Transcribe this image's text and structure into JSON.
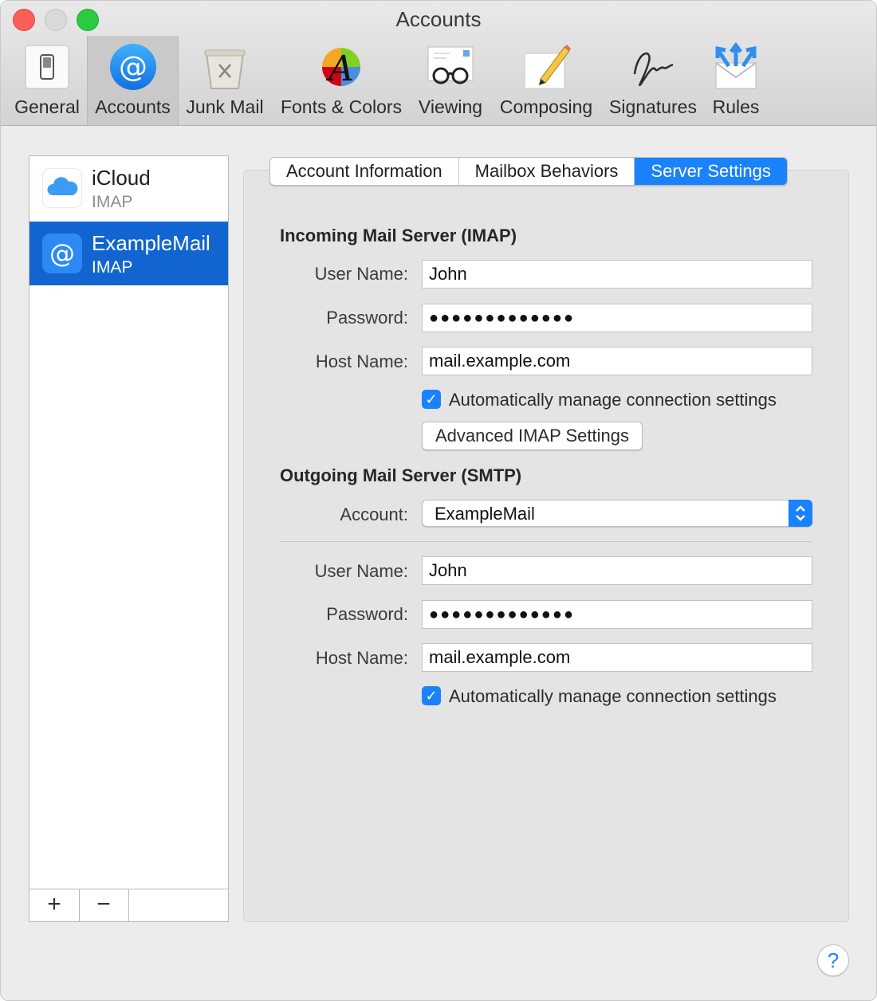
{
  "window": {
    "title": "Accounts"
  },
  "toolbar": {
    "items": [
      {
        "label": "General",
        "icon": "switch-icon"
      },
      {
        "label": "Accounts",
        "icon": "at-sign-icon"
      },
      {
        "label": "Junk Mail",
        "icon": "trash-bin-icon"
      },
      {
        "label": "Fonts & Colors",
        "icon": "font-color-wheel-icon"
      },
      {
        "label": "Viewing",
        "icon": "glasses-letter-icon"
      },
      {
        "label": "Composing",
        "icon": "pencil-paper-icon"
      },
      {
        "label": "Signatures",
        "icon": "signature-icon"
      },
      {
        "label": "Rules",
        "icon": "envelope-arrows-icon"
      }
    ],
    "active": "Accounts"
  },
  "accounts": [
    {
      "name": "iCloud",
      "type": "IMAP",
      "icon": "cloud-icon"
    },
    {
      "name": "ExampleMail",
      "type": "IMAP",
      "icon": "at-sign-icon"
    }
  ],
  "account_footer": {
    "add": "+",
    "remove": "−"
  },
  "tabs": [
    "Account Information",
    "Mailbox Behaviors",
    "Server Settings"
  ],
  "active_tab": "Server Settings",
  "incoming": {
    "title": "Incoming Mail Server (IMAP)",
    "user_label": "User Name:",
    "user": "John",
    "password_label": "Password:",
    "password": "●●●●●●●●●●●●●",
    "host_label": "Host Name:",
    "host": "mail.example.com",
    "auto_label": "Automatically manage connection settings",
    "auto_checked": true,
    "advanced_button": "Advanced IMAP Settings"
  },
  "outgoing": {
    "title": "Outgoing Mail Server (SMTP)",
    "account_label": "Account:",
    "account": "ExampleMail",
    "user_label": "User Name:",
    "user": "John",
    "password_label": "Password:",
    "password": "●●●●●●●●●●●●●",
    "host_label": "Host Name:",
    "host": "mail.example.com",
    "auto_label": "Automatically manage connection settings",
    "auto_checked": true
  },
  "help": {
    "label": "?"
  },
  "colors": {
    "accent": "#1a82fb",
    "selection": "#1265d0"
  }
}
